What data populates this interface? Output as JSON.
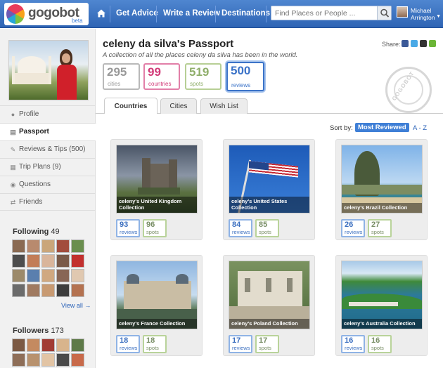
{
  "header": {
    "logo_text": "gogobot",
    "logo_badge": "beta",
    "nav": [
      "Get Advice",
      "Write a Review",
      "Destinations"
    ],
    "search_placeholder": "Find Places or People ...",
    "user_name": "Michael Arrington",
    "colors": {
      "bar": "#3a72c4",
      "accent": "#3f7fd6"
    }
  },
  "sidebar": {
    "items": [
      {
        "label": "Profile",
        "icon": "person-icon"
      },
      {
        "label": "Passport",
        "icon": "passport-icon"
      },
      {
        "label": "Reviews & Tips (500)",
        "icon": "pencil-icon"
      },
      {
        "label": "Trip Plans (9)",
        "icon": "map-icon"
      },
      {
        "label": "Questions",
        "icon": "speech-bubble-icon"
      },
      {
        "label": "Friends",
        "icon": "arrows-icon"
      }
    ],
    "following": {
      "label": "Following",
      "count": "49"
    },
    "view_all": "View all →",
    "followers": {
      "label": "Followers",
      "count": "173"
    }
  },
  "passport": {
    "title": "celeny da silva's Passport",
    "subtitle": "A collection of all the places celeny da silva has been in the world.",
    "share_label": "Share:",
    "stats": [
      {
        "value": "295",
        "label": "cities",
        "color": "#9a9a9a"
      },
      {
        "value": "99",
        "label": "countries",
        "color": "#d23a78"
      },
      {
        "value": "519",
        "label": "spots",
        "color": "#8fae6a"
      },
      {
        "value": "500",
        "label": "reviews",
        "color": "#3b73c8"
      }
    ],
    "stamp_text": "GOGOBOT",
    "tabs": [
      "Countries",
      "Cities",
      "Wish List"
    ],
    "sort": {
      "label": "Sort by:",
      "active": "Most Reviewed",
      "alt": "A - Z"
    }
  },
  "collections": [
    {
      "title": "celeny's United Kingdom Collection",
      "reviews": "93",
      "spots": "96"
    },
    {
      "title": "celeny's United States Collection",
      "reviews": "84",
      "spots": "85"
    },
    {
      "title": "celeny's Brazil Collection",
      "reviews": "26",
      "spots": "27"
    },
    {
      "title": "celeny's France Collection",
      "reviews": "18",
      "spots": "18"
    },
    {
      "title": "celeny's Poland Collection",
      "reviews": "17",
      "spots": "17"
    },
    {
      "title": "celeny's Australia Collection",
      "reviews": "16",
      "spots": "16"
    }
  ],
  "labels": {
    "reviews": "reviews",
    "spots": "spots"
  }
}
